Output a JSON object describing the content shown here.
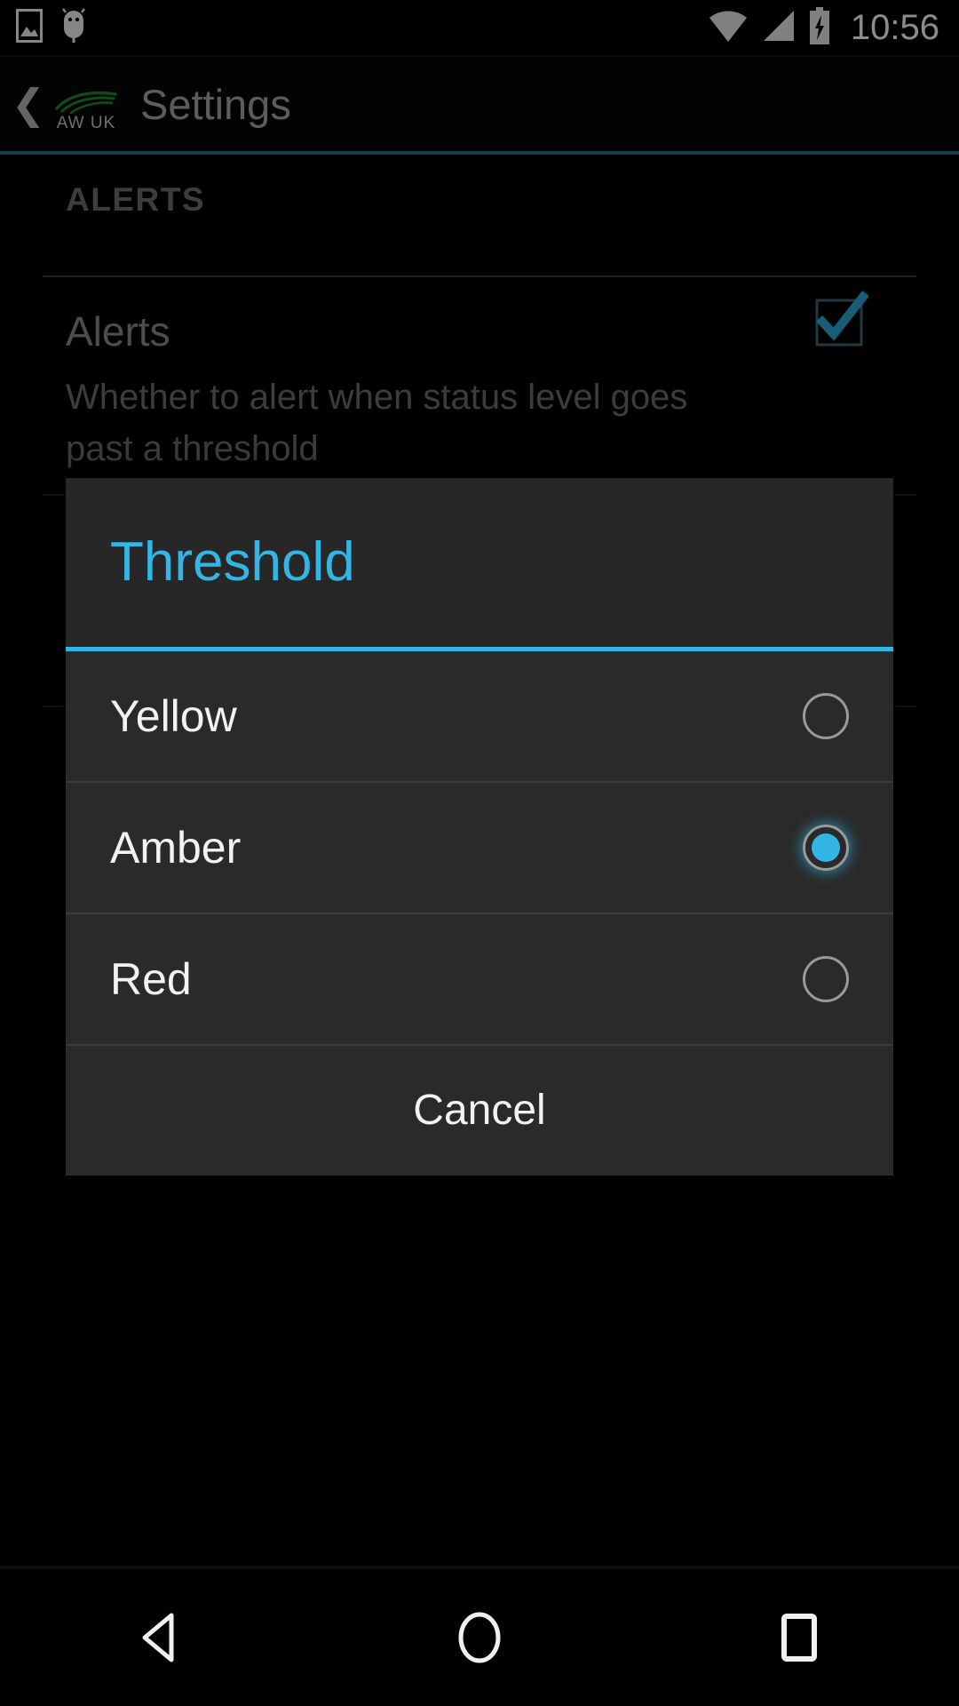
{
  "status_bar": {
    "icons": [
      "screenshot-icon",
      "usb-debug-icon",
      "wifi-icon",
      "signal-icon",
      "battery-charging-icon"
    ],
    "time": "10:56"
  },
  "action_bar": {
    "back_glyph": "❮",
    "logo_text": "AW UK",
    "logo_color": "#1d8a2b",
    "title": "Settings",
    "accent_underline": "#2b6c85"
  },
  "preferences": {
    "category": "ALERTS",
    "items": [
      {
        "title": "Alerts",
        "summary": "Whether to alert when status level goes past a threshold",
        "checkbox_checked": true,
        "checkbox_color": "#33b5e5"
      }
    ]
  },
  "dialog": {
    "title": "Threshold",
    "title_color": "#33b5e5",
    "accent": "#33b5e5",
    "background": "#2a2a2a",
    "options": [
      {
        "label": "Yellow",
        "selected": false
      },
      {
        "label": "Amber",
        "selected": true
      },
      {
        "label": "Red",
        "selected": false
      }
    ],
    "cancel_label": "Cancel"
  },
  "navigation_bar": {
    "buttons": [
      {
        "name": "back",
        "glyph": "triangle-left"
      },
      {
        "name": "home",
        "glyph": "circle"
      },
      {
        "name": "recents",
        "glyph": "square"
      }
    ]
  }
}
